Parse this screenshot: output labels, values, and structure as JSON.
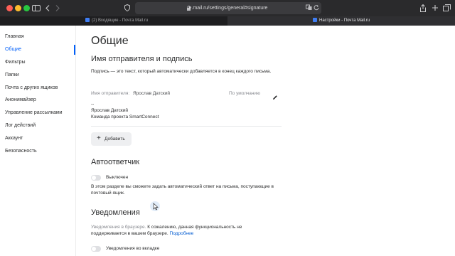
{
  "browser": {
    "url": "e.mail.ru/settings/general#signature",
    "tabs": [
      {
        "label": "(2) Входящие - Почта Mail.ru",
        "active": false
      },
      {
        "label": "Настройки - Почта Mail.ru",
        "active": true
      }
    ],
    "icons": [
      "sidebar-icon",
      "back-icon",
      "forward-icon",
      "shield-icon",
      "lock-icon",
      "translate-icon",
      "reload-icon",
      "share-icon",
      "new-tab-icon",
      "tabs-overview-icon"
    ]
  },
  "sidebar": {
    "items": [
      {
        "label": "Главная",
        "active": false
      },
      {
        "label": "Общие",
        "active": true
      },
      {
        "label": "Фильтры",
        "active": false
      },
      {
        "label": "Папки",
        "active": false
      },
      {
        "label": "Почта с других ящиков",
        "active": false
      },
      {
        "label": "Анонимайзер",
        "active": false
      },
      {
        "label": "Управление рассылками",
        "active": false
      },
      {
        "label": "Лог действий",
        "active": false
      },
      {
        "label": "Аккаунт",
        "active": false
      },
      {
        "label": "Безопасность",
        "active": false
      }
    ]
  },
  "main": {
    "title": "Общие",
    "signature": {
      "heading": "Имя отправителя и подпись",
      "description": "Подпись — это текст, который автоматически добавляется в конец каждого письма.",
      "sender_label": "Имя отправителя:",
      "sender_name": "Ярослав Датский",
      "default_label": "По умолчанию",
      "lines": [
        "--",
        "Ярослав Датский",
        "Команда проекта SmartConnect"
      ],
      "add_button": "Добавить"
    },
    "autoresponder": {
      "heading": "Автоответчик",
      "toggle_label": "Выключен",
      "enabled": false,
      "description": "В этом разделе вы сможете задать автоматический ответ на письма, поступающие в почтовый ящик."
    },
    "notifications": {
      "heading": "Уведомления",
      "browser_label": "Уведомления в браузере.",
      "browser_text": "К сожалению, данная функциональность не поддерживается в вашем браузере.",
      "more_link": "Подробнее",
      "tab_toggle_label": "Уведомления во вкладке",
      "tab_enabled": false
    }
  },
  "colors": {
    "accent": "#005ff9",
    "link": "#005bd1",
    "muted_text": "#87898f",
    "chrome": "#2a2a2c"
  }
}
